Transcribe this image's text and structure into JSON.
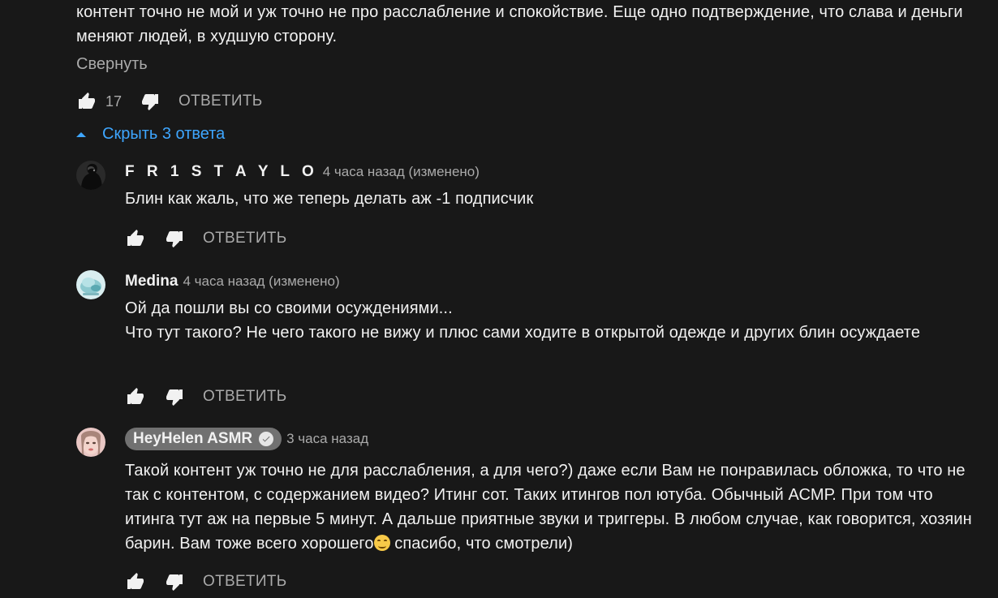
{
  "parent_comment": {
    "text": "контент точно не мой и уж точно не про расслабление и спокойствие. Еще одно подтверждение, что слава и деньги меняют людей, в худшую сторону.",
    "collapse_label": "Свернуть",
    "like_count": "17",
    "reply_label": "ОТВЕТИТЬ"
  },
  "replies_toggle": {
    "label": "Скрыть 3 ответа",
    "color": "#3ea6ff"
  },
  "replies": [
    {
      "author": "F R 1 S T A Y L O",
      "time": "4 часа назад (изменено)",
      "text": "Блин как жаль, что же теперь делать аж  -1 подписчик",
      "reply_label": "ОТВЕТИТЬ"
    },
    {
      "author": "Medina",
      "time": "4 часа назад (изменено)",
      "text_line1": "Ой да пошли вы со своими осуждениями...",
      "text_line2": "Что тут такого? Не чего такого не вижу  и плюс сами ходите в  открытой  одежде и других  блин осуждаете",
      "reply_label": "ОТВЕТИТЬ"
    },
    {
      "author": "HeyHelen ASMR",
      "verified": true,
      "time": "3 часа назад",
      "text_part1": "Такой контент уж точно не для расслабления, а для чего?) даже если Вам не понравилась обложка, то что не так с контентом, с содержанием видео? Итинг сот. Таких итингов пол ютуба. Обычный АСМР. При том что итинга тут аж на первые 5 минут. А дальше приятные звуки и триггеры. В любом случае, как говорится, хозяин барин. Вам тоже всего хорошего",
      "emoji": "smiling-face-emoji",
      "text_part2": " спасибо, что смотрели)",
      "reply_label": "ОТВЕТИТЬ"
    }
  ],
  "colors": {
    "background": "#181818",
    "text": "#f1f1f1",
    "secondary": "#aaaaaa",
    "link": "#3ea6ff",
    "owner_badge": "#717171"
  }
}
